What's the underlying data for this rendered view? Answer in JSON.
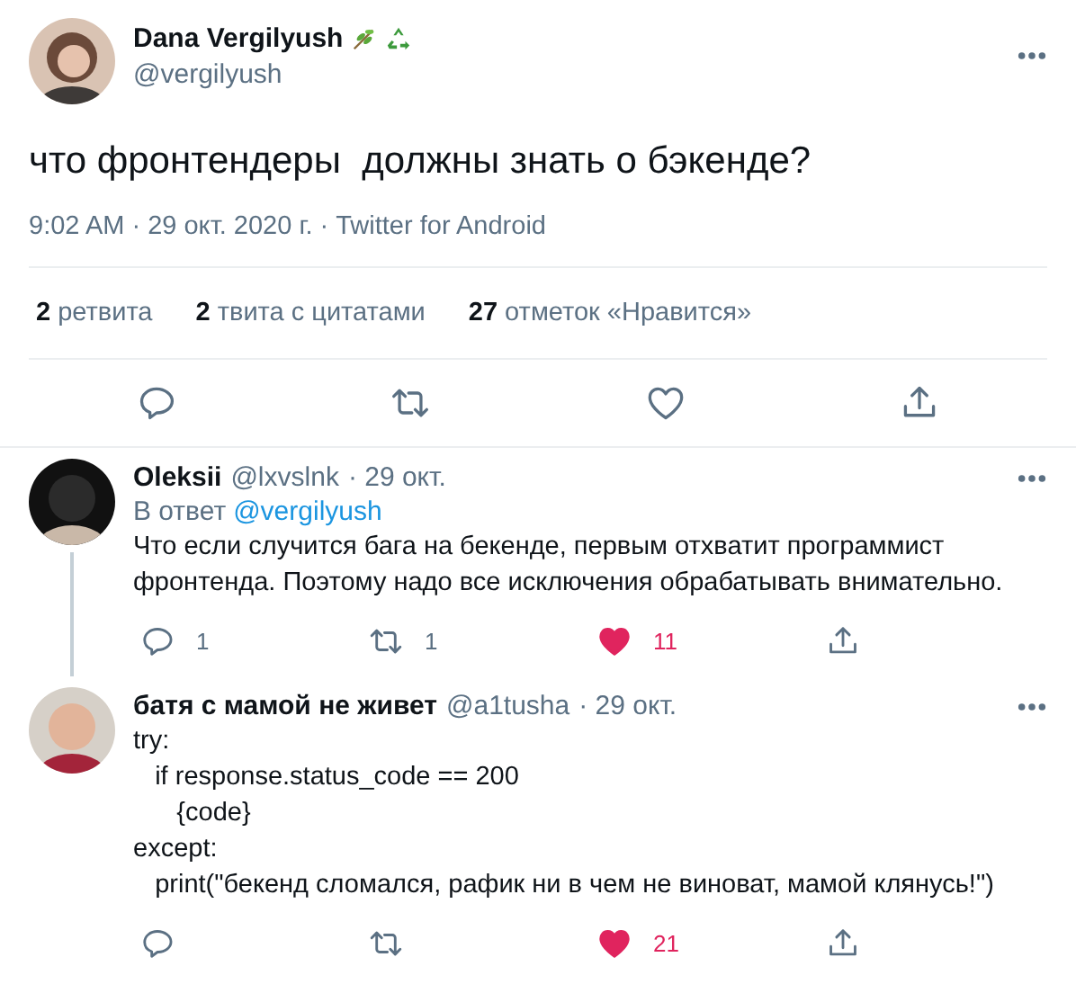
{
  "tweet": {
    "author": {
      "name": "Dana Vergilyush",
      "handle": "@vergilyush"
    },
    "text": "что фронтендеры  должны знать о бэкенде?",
    "meta": "9:02 AM · 29 окт. 2020 г. · Twitter for Android",
    "stats": [
      {
        "count": "2",
        "label": "ретвита"
      },
      {
        "count": "2",
        "label": "твита с цитатами"
      },
      {
        "count": "27",
        "label": "отметок «Нравится»"
      }
    ],
    "actions": [
      {
        "kind": "reply"
      },
      {
        "kind": "retweet"
      },
      {
        "kind": "like",
        "liked": false
      },
      {
        "kind": "share"
      }
    ]
  },
  "replies": [
    {
      "name": "Oleksii",
      "handle": "@lxvslnk",
      "date": "· 29 окт.",
      "reply_to_label": "В ответ",
      "reply_to": "@vergilyush",
      "thread_line": true,
      "text": "Что если случится бага на бекенде, первым отхватит программист фронтенда. Поэтому надо все исключения обрабатывать внимательно.",
      "actions": [
        {
          "kind": "reply",
          "count": "1"
        },
        {
          "kind": "retweet",
          "count": "1"
        },
        {
          "kind": "like",
          "liked": true,
          "count": "11"
        },
        {
          "kind": "share"
        }
      ]
    },
    {
      "name": "батя с мамой не живет",
      "handle": "@a1tusha",
      "date": "· 29 окт.",
      "thread_line": false,
      "lines": [
        "try:",
        "   if response.status_code == 200",
        "      {code}",
        "except:",
        "   print(\"бекенд сломался, рафик ни в чем не виноват, мамой клянусь!\")"
      ],
      "actions": [
        {
          "kind": "reply"
        },
        {
          "kind": "retweet"
        },
        {
          "kind": "like",
          "liked": true,
          "count": "21"
        },
        {
          "kind": "share"
        }
      ]
    }
  ]
}
